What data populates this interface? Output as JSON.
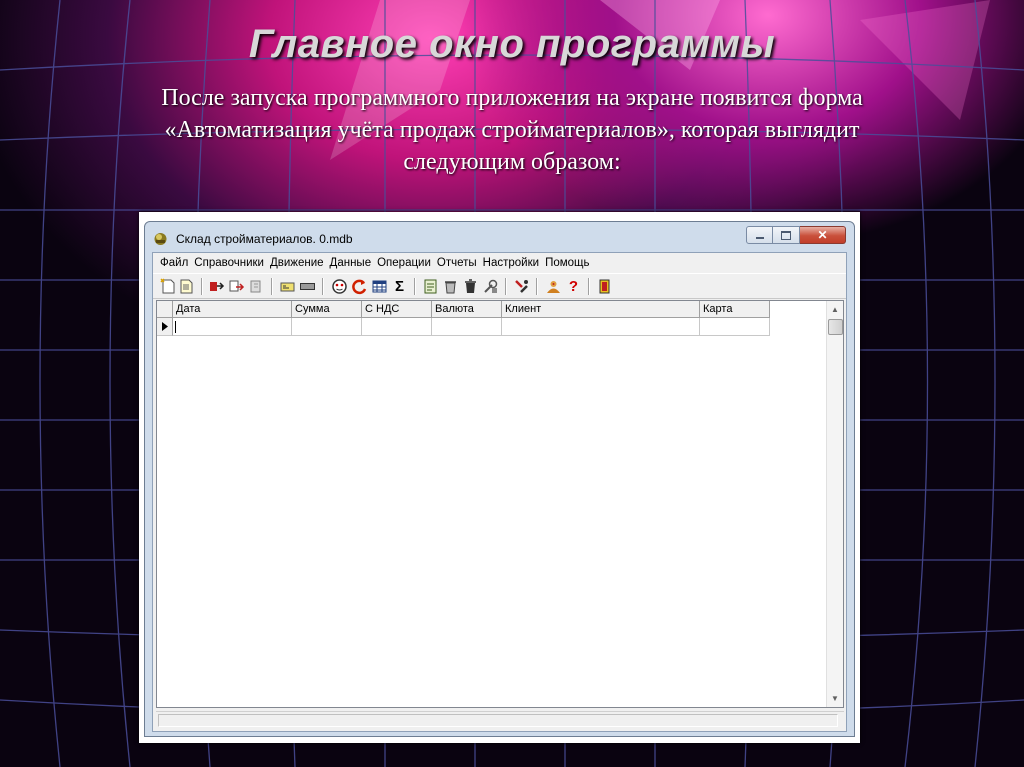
{
  "slide": {
    "title": "Главное окно программы",
    "text_lines": [
      "После запуска программного приложения на экране появится  форма",
      "«Автоматизация учёта продаж стройматериалов», которая выглядит",
      "следующим образом:"
    ]
  },
  "window": {
    "title": "Склад стройматериалов. 0.mdb",
    "menu": [
      "Файл",
      "Справочники",
      "Движение",
      "Данные",
      "Операции",
      "Отчеты",
      "Настройки",
      "Помощь"
    ],
    "toolbar_icons": [
      "new-document-icon",
      "open-document-icon",
      "add-record-icon",
      "edit-record-icon",
      "delete-record-icon",
      "card-reader-icon",
      "calculator-icon",
      "face-icon",
      "refresh-red-icon",
      "table-icon",
      "sigma-icon",
      "report-icon",
      "bin-icon",
      "trash-icon",
      "tools-icon",
      "settings-icon",
      "users-icon",
      "help-icon",
      "exit-door-icon"
    ],
    "grid": {
      "columns": [
        "Дата",
        "Сумма",
        "С НДС",
        "Валюта",
        "Клиент",
        "Карта"
      ],
      "rows": [
        [
          "",
          "",
          "",
          "",
          "",
          ""
        ]
      ]
    }
  },
  "colors": {
    "accent_background": "#e0208a",
    "window_frame": "#cfdceb",
    "close_button": "#c9503b"
  }
}
